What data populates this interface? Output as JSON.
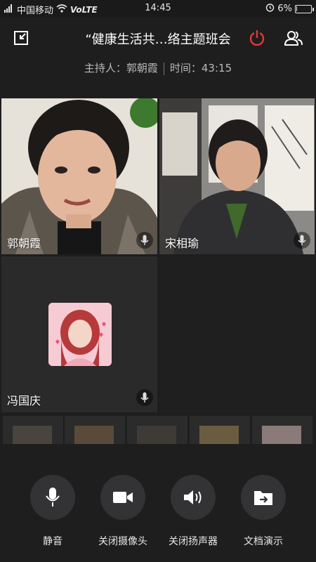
{
  "status_bar": {
    "carrier": "中国移动",
    "network": "VoLTE",
    "time": "14:45",
    "battery_percent": "6%",
    "battery_level": 0.06,
    "icons": [
      "signal-icon",
      "wifi-icon",
      "alarm-icon",
      "battery-icon"
    ]
  },
  "header": {
    "title": "“健康生活共…络主题班会",
    "host_label": "主持人：郭朝霞",
    "time_label": "时间：43:15",
    "accent_color": "#e53935"
  },
  "participants": [
    {
      "name": "郭朝霞",
      "mic": "mic-icon"
    },
    {
      "name": "宋相瑜",
      "mic": "mic-icon"
    },
    {
      "name": "冯国庆",
      "mic": "mic-icon"
    }
  ],
  "controls": [
    {
      "label": "静音",
      "icon": "microphone-icon"
    },
    {
      "label": "关闭摄像头",
      "icon": "video-camera-icon"
    },
    {
      "label": "关闭扬声器",
      "icon": "speaker-icon"
    },
    {
      "label": "文档演示",
      "icon": "share-document-icon"
    }
  ]
}
